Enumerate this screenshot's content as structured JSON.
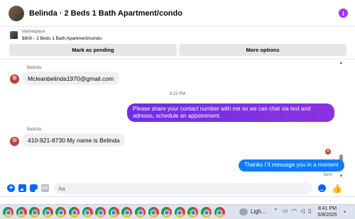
{
  "header": {
    "title": "Belinda · 2 Beds 1 Bath Apartment/condo",
    "info_icon": "info-icon"
  },
  "marketplace": {
    "label": "Marketplace",
    "item": "$900 - 2 Beds 1 Bath Apartment/condo",
    "mark_pending_label": "Mark as pending",
    "more_options_label": "More options"
  },
  "chat": {
    "messages": [
      {
        "direction": "in",
        "sender": "Belinda",
        "text": "Mcleanbelinda1970@gmail.com"
      },
      {
        "type": "timestamp",
        "text": "8:15 PM"
      },
      {
        "direction": "out",
        "text": "Please share your contact number with me so we can chat via text and adresss, schedule an appointment."
      },
      {
        "direction": "in",
        "sender": "Belinda",
        "text": "410-921-8730 My name is Belinda"
      },
      {
        "direction": "out",
        "text": "Thanks i\"il message you in a moment",
        "status": "Sent"
      }
    ]
  },
  "composer": {
    "placeholder": "Aa",
    "value": "",
    "icons": [
      "plus-circle-icon",
      "photo-icon",
      "sticker-icon",
      "gif-icon",
      "emoji-icon",
      "thumbs-up-icon"
    ]
  },
  "taskbar": {
    "app_count": 17,
    "app_icon": "chrome-icon",
    "weather_label": "Ligh...",
    "tray_icons": [
      "chevron-up-icon",
      "display-icon",
      "wifi-icon",
      "speaker-icon",
      "battery-icon"
    ],
    "time": "8:41 PM",
    "date": "5/8/2025"
  },
  "colors": {
    "accent_blue": "#0866ff",
    "outgoing_purple": "#7b2fe6",
    "outgoing_blue": "#0a7cff",
    "incoming_bg": "#f0f0f0",
    "info_purple": "#a033ff"
  }
}
